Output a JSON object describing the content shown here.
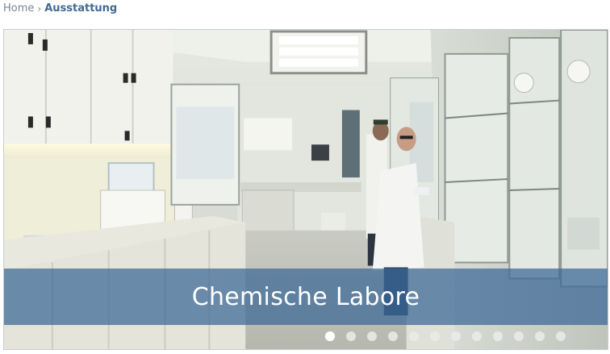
{
  "breadcrumb": {
    "home_label": "Home",
    "separator": "›",
    "current_label": "Ausstattung"
  },
  "slider": {
    "caption": "Chemische Labore",
    "image_subject": "laboratory-interior-with-scientists",
    "slide_count": 12,
    "active_slide": 1
  },
  "colors": {
    "breadcrumb_link": "#7a8693",
    "breadcrumb_current": "#3f6a96",
    "caption_band": "#3a6796"
  }
}
